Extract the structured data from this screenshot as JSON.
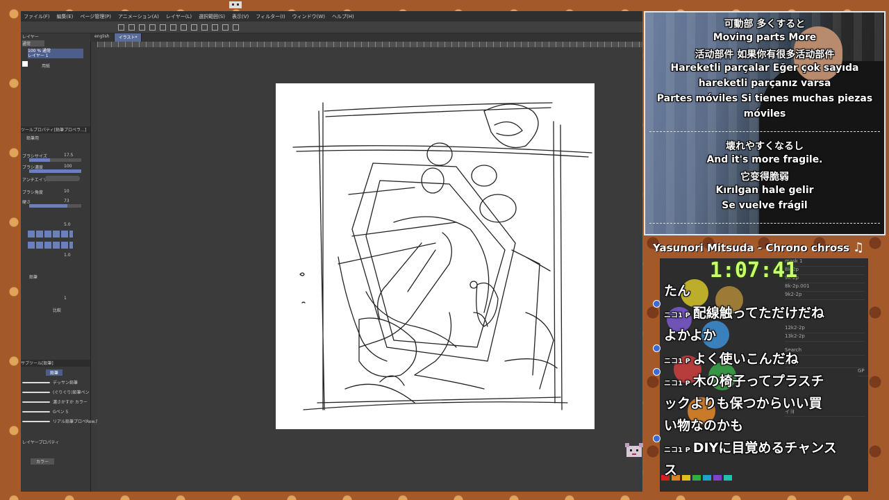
{
  "app": {
    "menu": [
      "ファイル(F)",
      "編集(E)",
      "ページ管理(P)",
      "アニメーション(A)",
      "レイヤー(L)",
      "選択範囲(S)",
      "表示(V)",
      "フィルター(I)",
      "ウィンドウ(W)",
      "ヘルプ(H)"
    ],
    "tabs": [
      "english",
      "イラスト*"
    ],
    "left_panel": {
      "layer_label": "レイヤー",
      "blend_mode": "通常",
      "layer_name": "100 % 通常\nレイヤー 1",
      "paper_label": "用紙",
      "tool_property_title": "ツールプロパティ[鉛筆プロペラ…]",
      "tool_name": "鉛筆用",
      "size_label": "ブラシサイズ",
      "size_value": "17.5",
      "density_label": "ブラシ濃度",
      "density_value": "100",
      "aa_label": "アンチエイリアス",
      "angle_label": "ブラシ角度",
      "angle_value": "10",
      "hardness_label": "硬さ",
      "hardness_value": "73",
      "bottom_size_value": "5.0",
      "pen_value": "1.0",
      "ink_label": "鉛筆",
      "opacity_value": "1",
      "compare_label": "比較",
      "brush_section": "サブツール[鉛筆]",
      "brush_tab": "鉛筆",
      "brushes": [
        "デッサン鉛筆",
        "(ぐりぐり)鉛筆ペン",
        "濃さかすか カラー",
        "Gペン 5",
        "リアル鉛筆プロペRew.用"
      ],
      "layer_property": "レイヤープロパティ",
      "color_label": "カラー"
    }
  },
  "overlay": {
    "subtitles_top": [
      "可動部 多くすると",
      "Moving parts More",
      "活动部件 如果你有很多活动部件",
      "Hareketli parçalar Eğer çok sayıda",
      "hareketli parçanız varsa",
      "Partes móviles Si tienes muchas piezas",
      "móviles"
    ],
    "subtitles_bottom": [
      "壊れやすくなるし",
      "And it's more fragile.",
      "它变得脆弱",
      "Kırılgan hale gelir",
      "Se vuelve frágil"
    ],
    "now_playing": "Yasunori Mitsuda - Chrono chross",
    "timer": "1:07:41",
    "chat": [
      {
        "tag": "",
        "text": "たん"
      },
      {
        "tag": "ニコ1 P",
        "text": "配線触ってただけだね"
      },
      {
        "tag": "",
        "text": "よかよか"
      },
      {
        "tag": "ニコ1 P",
        "text": "よく使いこんだね"
      },
      {
        "tag": "ニコ1 P",
        "text": "木の椅子ってプラスチ"
      },
      {
        "tag": "",
        "text": "ックよりも保つからいい買"
      },
      {
        "tag": "",
        "text": "い物なのかも"
      },
      {
        "tag": "ニコ1 P",
        "text": "DIYに目覚めるチャンス"
      },
      {
        "tag": "",
        "text": "ス"
      }
    ],
    "right_app_rows": [
      "mask 1",
      "8k-2p",
      "9k-2p",
      "8k-2p.001",
      "9k2-2p",
      "12k2-2p",
      "13k2-2p",
      "Search",
      "6k-2p",
      "GP",
      "イヨ"
    ]
  },
  "colors": {
    "timer": "#c9ff6a",
    "tab_active": "#5a6c9a",
    "accent": "#6b7fb8"
  }
}
